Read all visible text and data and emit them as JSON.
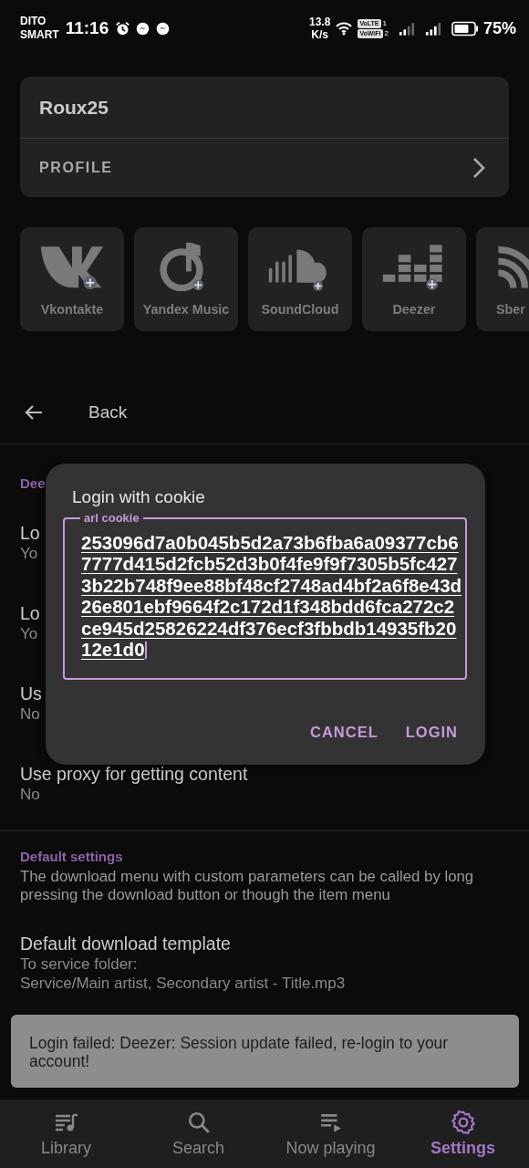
{
  "status_bar": {
    "carrier": [
      "DITO",
      "SMART"
    ],
    "time": "11:16",
    "net_speed": [
      "13.8",
      "K/s"
    ],
    "volte": "VoLTE",
    "sim_1": "1",
    "vowifi": "VoWiFi",
    "sim_2": "2",
    "battery": "75%"
  },
  "profile": {
    "name": "Roux25",
    "label": "PROFILE"
  },
  "services": [
    {
      "name": "Vkontakte",
      "kind": "vk"
    },
    {
      "name": "Yandex Music",
      "kind": "yandex"
    },
    {
      "name": "SoundCloud",
      "kind": "soundcloud"
    },
    {
      "name": "Deezer",
      "kind": "deezer"
    },
    {
      "name": "Sber",
      "kind": "sber"
    }
  ],
  "back": {
    "label": "Back"
  },
  "sections": [
    {
      "header": "Dee",
      "rows": [
        {
          "title": "Lo",
          "subtitle": [
            "Yo"
          ]
        },
        {
          "title": "Lo",
          "subtitle": [
            "Yo"
          ]
        },
        {
          "title": "Us",
          "subtitle": [
            "No"
          ]
        },
        {
          "title": "Use proxy for getting content",
          "subtitle": [
            "No"
          ]
        }
      ]
    },
    {
      "header": "Default settings",
      "description": "The download menu with custom parameters can be called by long pressing the download button or though the item menu",
      "rows": [
        {
          "title": "Default download template",
          "subtitle": [
            "To service folder:",
            "Service/Main artist, Secondary artist - Title.mp3"
          ]
        }
      ]
    }
  ],
  "dialog": {
    "title": "Login with cookie",
    "field": {
      "label": "arl cookie",
      "value": "253096d7a0b045b5d2a73b6fba6a09377cb67777d415d2fcb52d3b0f4fe9f9f7305b5fc4273b22b748f9ee88bf48cf2748ad4bf2a6f8e43d26e801ebf9664f2c172d1f348bdd6fca272c2ce945d25826224df376ecf3fbbdb14935fb2012e1d0"
    },
    "buttons": [
      "CANCEL",
      "LOGIN"
    ]
  },
  "toast": {
    "message": "Login failed: Deezer: Session update failed, re-login to your account!"
  },
  "nav": [
    {
      "label": "Library",
      "kind": "library",
      "selected": false
    },
    {
      "label": "Search",
      "kind": "search",
      "selected": false
    },
    {
      "label": "Now playing",
      "kind": "queue",
      "selected": false
    },
    {
      "label": "Settings",
      "kind": "settings",
      "selected": true
    }
  ]
}
